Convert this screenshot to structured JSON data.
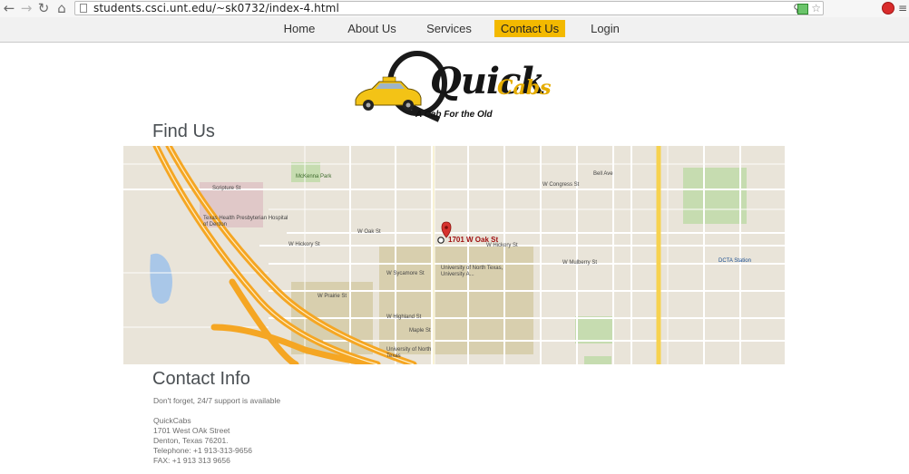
{
  "browser": {
    "url": "students.csci.unt.edu/~sk0732/index-4.html"
  },
  "nav": {
    "items": [
      {
        "label": "Home"
      },
      {
        "label": "About Us"
      },
      {
        "label": "Services"
      },
      {
        "label": "Contact Us",
        "active": true
      },
      {
        "label": "Login"
      }
    ]
  },
  "logo": {
    "main": "Quick",
    "sub": "Cabs",
    "tagline": "A Cab For the Old"
  },
  "find_us": {
    "title": "Find Us",
    "map_marker_label": "1701 W Oak St",
    "map_labels": {
      "mckenna_park": "McKenna Park",
      "w_oak_st": "W Oak St",
      "w_hickory_st": "W Hickory St",
      "university": "University of North Texas, University A...",
      "texas_health": "Texas Health Presbyterian Hospital of Denton",
      "bell_ave": "Bell Ave",
      "w_congress_st": "W Congress St",
      "dcta_station": "DCTA Station",
      "w_prairie_st": "W Prairie St",
      "w_highland_st": "W Highland St",
      "maple_st": "Maple St",
      "scripture_st": "Scripture St",
      "w_sycamore_st": "W Sycamore St",
      "w_mulberry_st": "W Mulberry St",
      "twu_texas": "University of North Texas"
    }
  },
  "contact": {
    "title": "Contact Info",
    "support": "Don't forget, 24/7 support is available",
    "company": "QuickCabs",
    "street": "1701 West OAk Street",
    "city": "Denton, Texas 76201.",
    "telephone": "Telephone: +1 913-313-9656",
    "fax": "FAX: +1 913 313 9656"
  },
  "colors": {
    "accent": "#f3b900",
    "heading": "#4a4f53",
    "highway": "#f5a623",
    "map_bg": "#e9e4d9"
  }
}
